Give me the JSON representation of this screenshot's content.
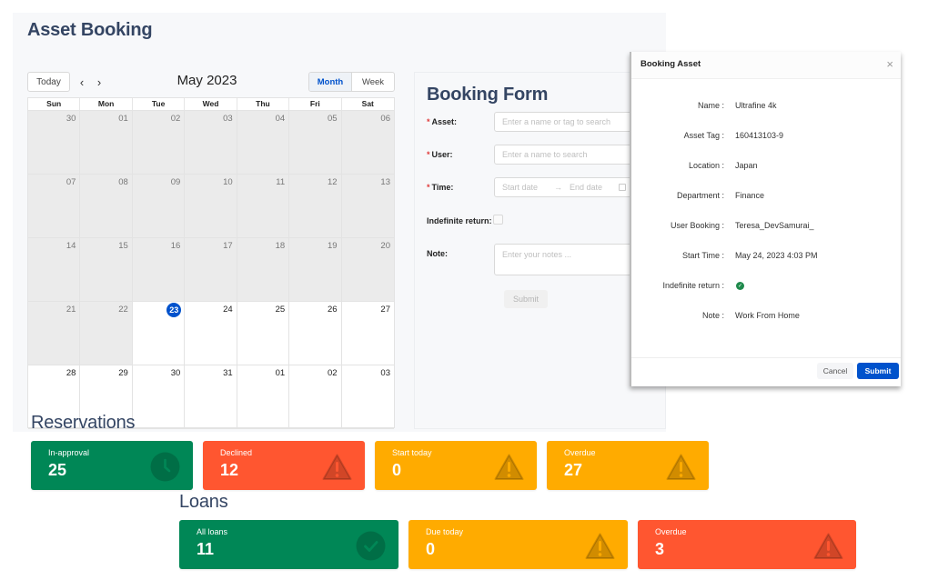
{
  "page": {
    "title": "Asset Booking"
  },
  "calendar": {
    "today_label": "Today",
    "prev_label": "‹",
    "next_label": "›",
    "month_title": "May 2023",
    "views": [
      {
        "label": "Month",
        "active": true
      },
      {
        "label": "Week",
        "active": false
      }
    ],
    "weekdays": [
      "Sun",
      "Mon",
      "Tue",
      "Wed",
      "Thu",
      "Fri",
      "Sat"
    ],
    "weeks": [
      [
        {
          "d": "30",
          "s": "past"
        },
        {
          "d": "01",
          "s": "past"
        },
        {
          "d": "02",
          "s": "past"
        },
        {
          "d": "03",
          "s": "past"
        },
        {
          "d": "04",
          "s": "past"
        },
        {
          "d": "05",
          "s": "past"
        },
        {
          "d": "06",
          "s": "past"
        }
      ],
      [
        {
          "d": "07",
          "s": "past"
        },
        {
          "d": "08",
          "s": "past"
        },
        {
          "d": "09",
          "s": "past"
        },
        {
          "d": "10",
          "s": "past"
        },
        {
          "d": "11",
          "s": "past"
        },
        {
          "d": "12",
          "s": "past"
        },
        {
          "d": "13",
          "s": "past"
        }
      ],
      [
        {
          "d": "14",
          "s": "past"
        },
        {
          "d": "15",
          "s": "past"
        },
        {
          "d": "16",
          "s": "past"
        },
        {
          "d": "17",
          "s": "past"
        },
        {
          "d": "18",
          "s": "past"
        },
        {
          "d": "19",
          "s": "past"
        },
        {
          "d": "20",
          "s": "past"
        }
      ],
      [
        {
          "d": "21",
          "s": "past"
        },
        {
          "d": "22",
          "s": "past"
        },
        {
          "d": "23",
          "s": "today"
        },
        {
          "d": "24",
          "s": "future"
        },
        {
          "d": "25",
          "s": "future"
        },
        {
          "d": "26",
          "s": "future"
        },
        {
          "d": "27",
          "s": "future"
        }
      ],
      [
        {
          "d": "28",
          "s": "future"
        },
        {
          "d": "29",
          "s": "future"
        },
        {
          "d": "30",
          "s": "future"
        },
        {
          "d": "31",
          "s": "future"
        },
        {
          "d": "01",
          "s": "future"
        },
        {
          "d": "02",
          "s": "future"
        },
        {
          "d": "03",
          "s": "future"
        }
      ]
    ]
  },
  "booking_form": {
    "title": "Booking Form",
    "asset": {
      "label": "Asset",
      "placeholder": "Enter a name or tag to search",
      "required": true
    },
    "user": {
      "label": "User",
      "placeholder": "Enter a name to search",
      "required": true
    },
    "time": {
      "label": "Time",
      "start_placeholder": "Start date",
      "end_placeholder": "End date",
      "arrow": "→",
      "required": true
    },
    "indefinite_return": {
      "label": "Indefinite return",
      "checked": false
    },
    "note": {
      "label": "Note",
      "placeholder": "Enter your notes ..."
    },
    "submit_label": "Submit",
    "required_mark": "*",
    "colon": ":"
  },
  "modal": {
    "title": "Booking Asset",
    "close_icon": "×",
    "fields": [
      {
        "key": "Name",
        "value": "Ultrafine 4k"
      },
      {
        "key": "Asset Tag",
        "value": "160413103-9"
      },
      {
        "key": "Location",
        "value": "Japan"
      },
      {
        "key": "Department",
        "value": "Finance"
      },
      {
        "key": "User Booking",
        "value": "Teresa_DevSamurai_"
      },
      {
        "key": "Start Time",
        "value": "May 24, 2023 4:03 PM"
      },
      {
        "key": "Indefinite return",
        "value": "check-circle",
        "checked": true
      },
      {
        "key": "Note",
        "value": "Work From Home"
      }
    ],
    "cancel_label": "Cancel",
    "submit_label": "Submit"
  },
  "reservations": {
    "title": "Reservations",
    "cards": [
      {
        "label": "In-approval",
        "value": "25",
        "color": "#008756",
        "icon": "clock-icon"
      },
      {
        "label": "Declined",
        "value": "12",
        "color": "#ff5630",
        "icon": "warning-icon"
      },
      {
        "label": "Start today",
        "value": "0",
        "color": "#ffab00",
        "icon": "warning-icon"
      },
      {
        "label": "Overdue",
        "value": "27",
        "color": "#ffab00",
        "icon": "warning-icon"
      }
    ]
  },
  "loans": {
    "title": "Loans",
    "cards": [
      {
        "label": "All loans",
        "value": "11",
        "color": "#008756",
        "icon": "check-icon"
      },
      {
        "label": "Due today",
        "value": "0",
        "color": "#ffab00",
        "icon": "warning-icon"
      },
      {
        "label": "Overdue",
        "value": "3",
        "color": "#ff5630",
        "icon": "warning-icon"
      }
    ]
  },
  "colors": {
    "primary": "#0052cc",
    "heading": "#344563",
    "success": "#008756",
    "danger": "#ff5630",
    "warning": "#ffab00"
  }
}
